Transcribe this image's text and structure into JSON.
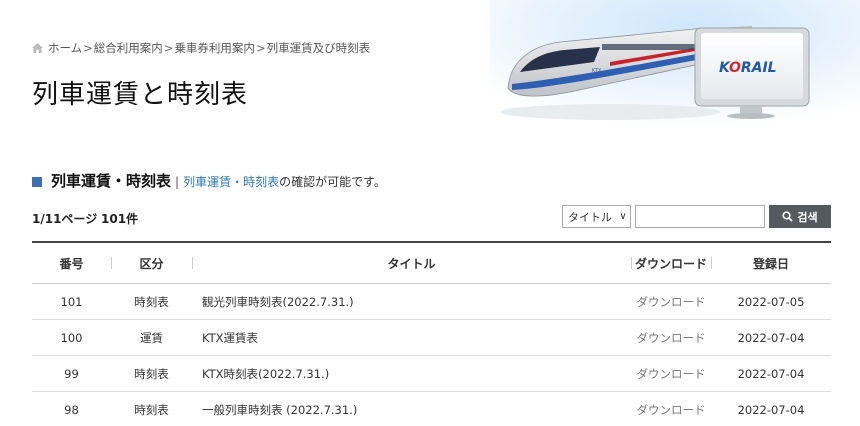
{
  "breadcrumb": {
    "items": [
      "ホーム",
      "総合利用案内",
      "乗車券利用案内",
      "列車運賃及び時刻表"
    ],
    "separator": ">"
  },
  "page": {
    "title": "列車運賃と時刻表"
  },
  "hero": {
    "logo_text": "KORAIL",
    "train_badge": "KTX"
  },
  "section": {
    "title": "列車運賃・時刻表",
    "bar": "|",
    "link": "列車運賃・時刻表",
    "desc": "の確認が可能です。"
  },
  "list": {
    "page_info": "1/11ページ",
    "total": "101件"
  },
  "search": {
    "select_value": "タイトル",
    "input_value": "",
    "button_label": "검색"
  },
  "table": {
    "headers": [
      "番号",
      "区分",
      "タイトル",
      "ダウンロード",
      "登録日"
    ],
    "rows": [
      {
        "no": "101",
        "type": "時刻表",
        "title": "観光列車時刻表(2022.7.31.)",
        "download": "ダウンロード",
        "date": "2022-07-05"
      },
      {
        "no": "100",
        "type": "運賃",
        "title": "KTX運賃表",
        "download": "ダウンロード",
        "date": "2022-07-04"
      },
      {
        "no": "99",
        "type": "時刻表",
        "title": "KTX時刻表(2022.7.31.)",
        "download": "ダウンロード",
        "date": "2022-07-04"
      },
      {
        "no": "98",
        "type": "時刻表",
        "title": "一般列車時刻表 (2022.7.31.)",
        "download": "ダウンロード",
        "date": "2022-07-04"
      }
    ]
  },
  "colors": {
    "accent": "#3b6fb6",
    "link": "#2a7ab0",
    "button": "#555a5e",
    "brand_blue": "#1f5aa8",
    "brand_red": "#d9262b"
  },
  "icons": {
    "home": "home-icon",
    "search": "search-icon",
    "dropdown": "chevron-down-icon"
  }
}
